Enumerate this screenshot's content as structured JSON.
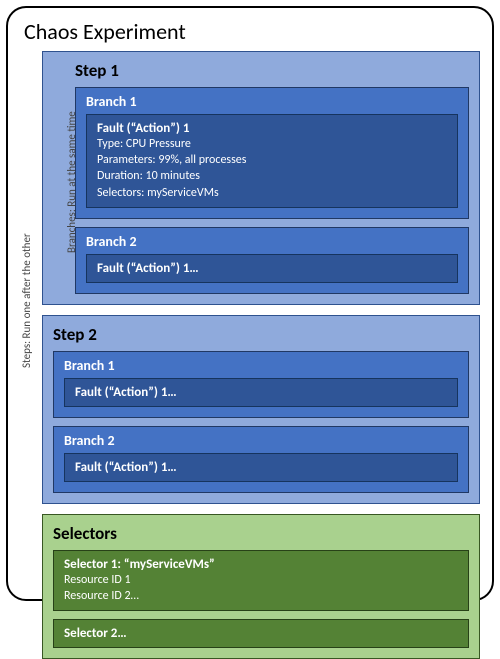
{
  "title": "Chaos Experiment",
  "sideLabels": {
    "steps": "Steps: Run one after the other",
    "branches": "Branches: Run at the same time"
  },
  "steps": [
    {
      "title": "Step 1",
      "branches": [
        {
          "title": "Branch 1",
          "fault": {
            "title": "Fault (“Action”) 1",
            "type": "Type: CPU Pressure",
            "parameters": "Parameters: 99%, all processes",
            "duration": "Duration: 10 minutes",
            "selectors": "Selectors: myServiceVMs"
          }
        },
        {
          "title": "Branch 2",
          "fault": {
            "title": "Fault (“Action”) 1…"
          }
        }
      ]
    },
    {
      "title": "Step 2",
      "branches": [
        {
          "title": "Branch 1",
          "fault": {
            "title": "Fault (“Action”) 1…"
          }
        },
        {
          "title": "Branch 2",
          "fault": {
            "title": "Fault (“Action”) 1…"
          }
        }
      ]
    }
  ],
  "selectorsSection": {
    "title": "Selectors",
    "items": [
      {
        "title": "Selector 1: “myServiceVMs”",
        "lines": [
          "Resource ID 1",
          "Resource ID 2…"
        ]
      },
      {
        "title": "Selector 2…",
        "lines": []
      }
    ]
  }
}
